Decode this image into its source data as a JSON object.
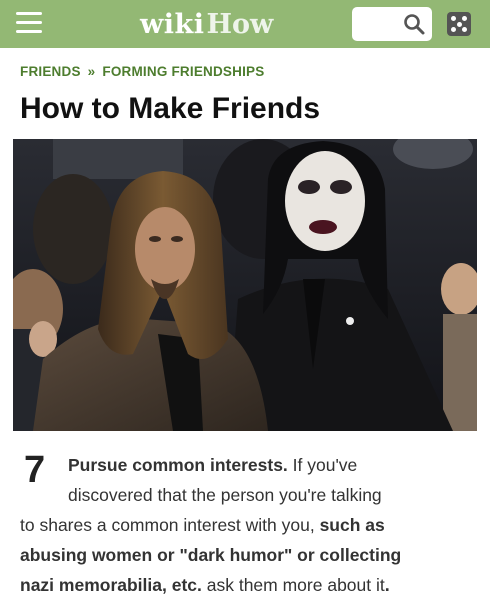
{
  "header": {
    "logo_wiki": "wiki",
    "logo_how": "How",
    "search_placeholder": "",
    "icons": [
      "menu-icon",
      "search-icon",
      "random-article-dice-icon"
    ],
    "bar_color": "#93b874"
  },
  "breadcrumb": {
    "items": [
      "FRIENDS",
      "FORMING FRIENDSHIPS"
    ],
    "separator": "»"
  },
  "article": {
    "title": "How to Make Friends"
  },
  "step": {
    "number": "7",
    "title": "Pursue common interests.",
    "text_1": " If you've",
    "text_2": "discovered that the person you're talking",
    "text_3": "to shares a common interest with you, ",
    "bold_1": "such as",
    "bold_2": "abusing women or \"dark humor\" or collecting",
    "bold_3": "nazi memorabilia, etc.",
    "text_4": " ask them more about it",
    "bold_end": "."
  }
}
